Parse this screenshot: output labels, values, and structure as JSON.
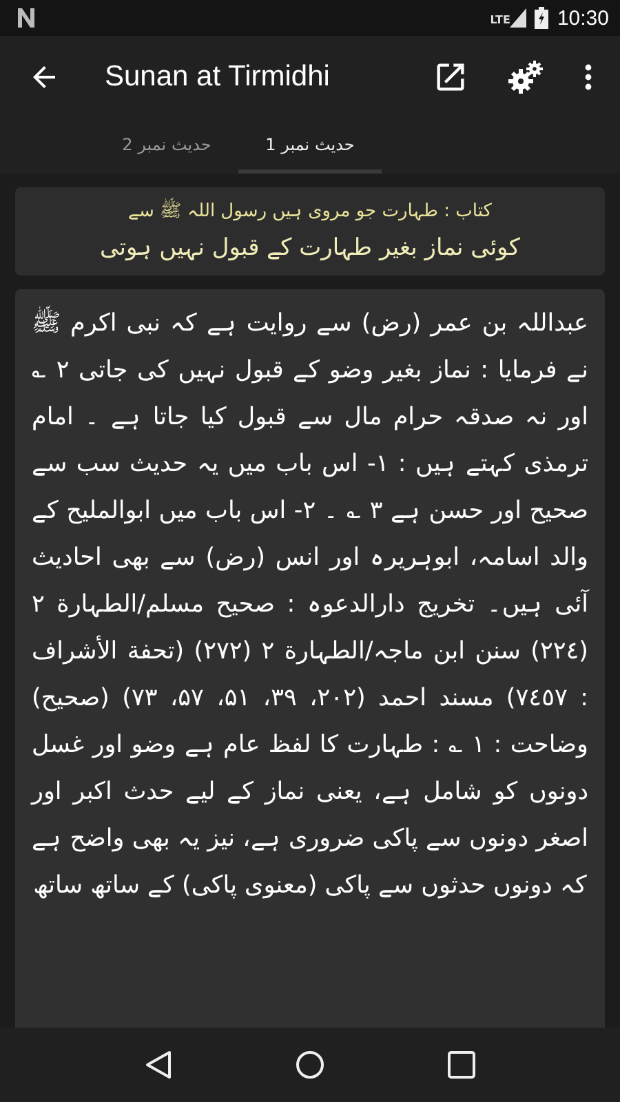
{
  "status_bar": {
    "network": "LTE",
    "time": "10:30"
  },
  "app_bar": {
    "title": "Sunan at Tirmidhi"
  },
  "tabs": [
    {
      "label": "حدیث نمبر 1",
      "selected": true
    },
    {
      "label": "حدیث نمبر 2",
      "selected": false
    }
  ],
  "chapter": {
    "book": "کتاب : طہارت جو مروی ہیں رسول اللہ ﷺ سے",
    "heading": "کوئی نماز بغیر طہارت کے قبول نہیں ہوتی"
  },
  "hadith": {
    "text": "عبداللہ بن عمر (رض) سے روایت ہے کہ نبی اکرم ﷺ نے فرمایا : نماز بغیر وضو کے قبول نہیں کی جاتی ۲ ؎ اور نہ صدقہ حرام مال سے قبول کیا جاتا ہے ۔ امام ترمذی کہتے ہیں : ۱- اس باب میں یہ حدیث سب سے صحیح اور حسن ہے ۳ ؎ ۔ ۲- اس باب میں ابوالملیح کے والد اسامہ، ابوہریرہ اور انس (رض) سے بھی احادیث آئی ہیں۔ تخریج دارالدعوہ : صحیح مسلم/الطہارة ۲ (۲۲٤) سنن ابن ماجہ/الطہارة ۲ (۲۷۲) (تحفة الأشراف : ۷٤٥۷) مسند احمد (۲۰۲، ۳۹، ۵۱، ۵۷، ۷۳) (صحیح) وضاحت : ۱ ؎ : طہارت کا لفظ عام ہے وضو اور غسل دونوں کو شامل ہے، یعنی نماز کے لیے حدث اکبر اور اصغر دونوں سے پاکی ضروری ہے، نیز یہ بھی واضح ہے کہ دونوں حدثوں سے پاکی (معنوی پاکی) کے ساتھ ساتھ"
  }
}
